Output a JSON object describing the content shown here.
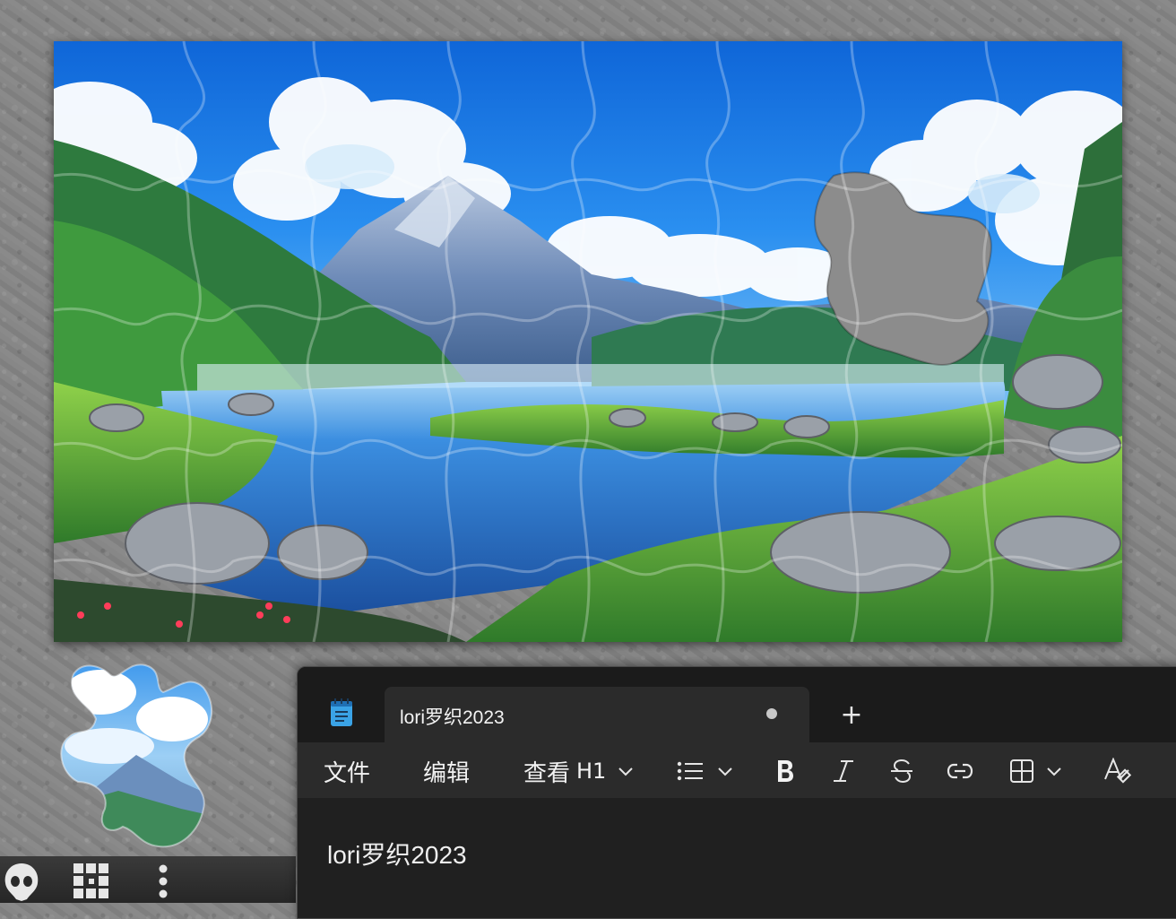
{
  "puzzle": {
    "image": "anime-mountain-lake-landscape",
    "colors": {
      "sky": "#1f7fe0",
      "mountain": "#5d7fb0",
      "water": "#2f7fd6",
      "grass": "#5fb83a",
      "rock": "#a9a9a9"
    }
  },
  "loose_piece": {
    "icon": "puzzle-piece-icon"
  },
  "game_toolbar": {
    "buttons": [
      {
        "icon": "ghost-preview-icon"
      },
      {
        "icon": "grid-scatter-icon"
      },
      {
        "icon": "more-vertical-icon"
      }
    ]
  },
  "notepad": {
    "tab": {
      "title": "lori罗织2023",
      "icon": "notepad-icon"
    },
    "new_tab_label": "+",
    "menu": {
      "file": "文件",
      "edit": "编辑",
      "view": "查看"
    },
    "toolbar": {
      "heading": "H1",
      "icons": [
        "chevron-down-icon",
        "bullet-list-icon",
        "bold-icon",
        "italic-icon",
        "strikethrough-icon",
        "link-icon",
        "table-icon",
        "clear-format-icon"
      ]
    },
    "content": "lori罗织2023"
  }
}
